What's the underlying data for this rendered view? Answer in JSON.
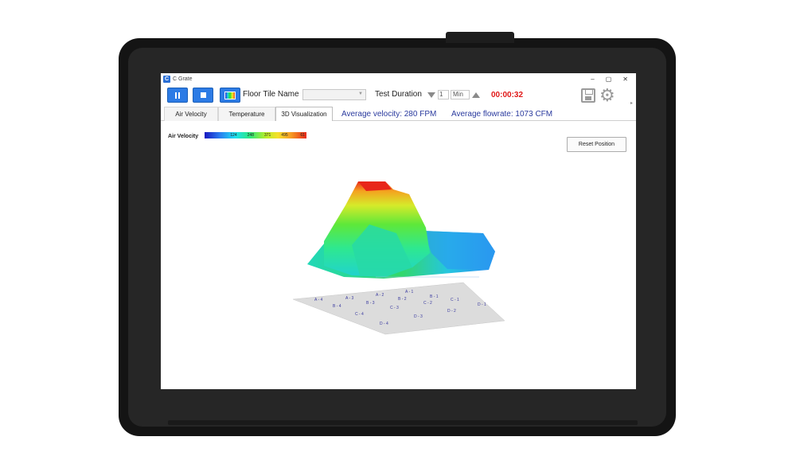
{
  "app": {
    "title": "C Grate",
    "window_controls": [
      "–",
      "▢",
      "✕"
    ]
  },
  "toolbar": {
    "floor_tile_label": "Floor Tile Name",
    "floor_tile_value": "",
    "test_duration_label": "Test Duration",
    "duration_value": "1",
    "duration_unit": "Min",
    "timer": "00:00:32"
  },
  "tabs": [
    {
      "label": "Air Velocity",
      "active": false
    },
    {
      "label": "Temperature",
      "active": false
    },
    {
      "label": "3D Visualization",
      "active": true
    }
  ],
  "metrics": {
    "avg_velocity": "Average velocity: 280 FPM",
    "avg_flowrate": "Average flowrate: 1073 CFM"
  },
  "visualization": {
    "legend_label": "Air Velocity",
    "colorbar_ticks": [
      "",
      "124",
      "248",
      "371",
      "495",
      "61"
    ],
    "reset_label": "Reset Position",
    "grid_labels": [
      "A - 1",
      "B - 1",
      "C - 1",
      "D - 1",
      "A - 2",
      "B - 2",
      "C - 2",
      "D - 2",
      "A - 3",
      "B - 3",
      "C - 3",
      "D - 3",
      "A - 4",
      "B - 4",
      "C - 4",
      "D - 4"
    ]
  },
  "colors": {
    "accent": "#2c7be5",
    "timer": "#e01818",
    "metric_text": "#2a3a9e",
    "surface_peak": "#e82a1a",
    "surface_low": "#2a7cf0"
  }
}
